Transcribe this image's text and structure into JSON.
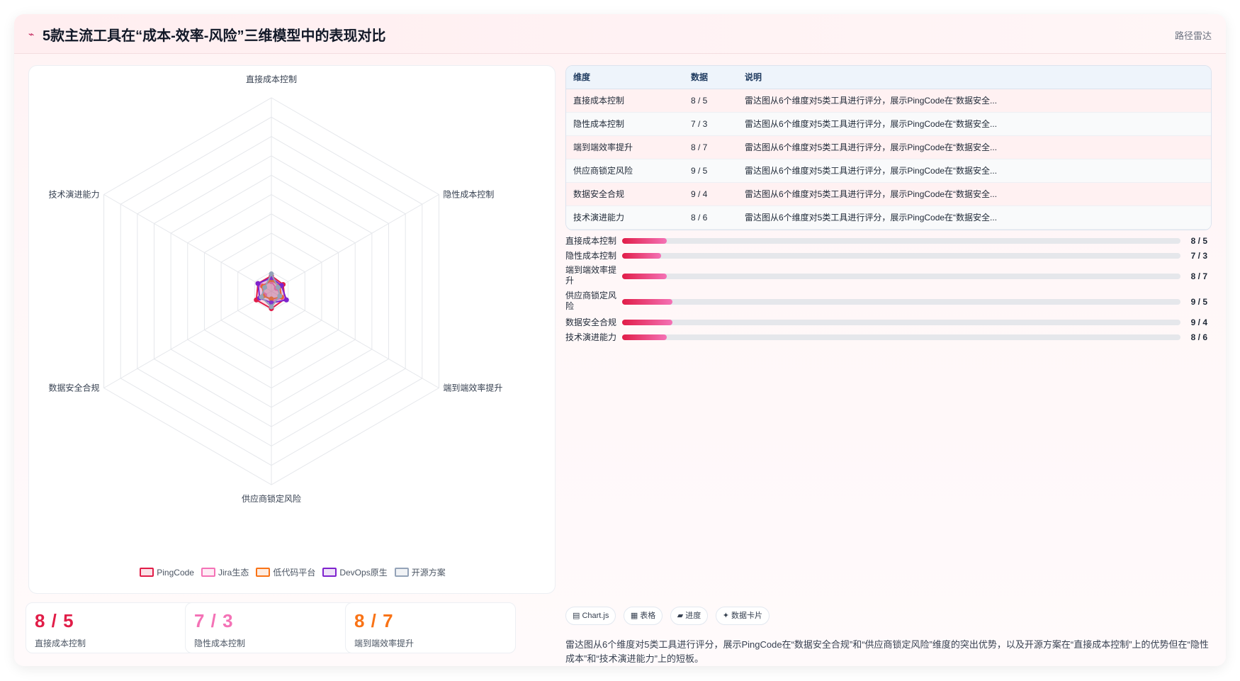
{
  "header": {
    "title_icon": "⌁",
    "title": "5款主流工具在“成本-效率-风险”三维模型中的表现对比",
    "badge": "路径雷达"
  },
  "chart_data": {
    "type": "radar",
    "axes": [
      "直接成本控制",
      "隐性成本控制",
      "端到端效率提升",
      "供应商锁定风险",
      "数据安全合规",
      "技术演进能力"
    ],
    "rlim": [
      0,
      100
    ],
    "rings": 10,
    "series": [
      {
        "name": "PingCode",
        "values": [
          8,
          7,
          8,
          9,
          9,
          8
        ],
        "color": "#e11d48"
      },
      {
        "name": "Jira生态",
        "values": [
          5,
          3,
          7,
          5,
          4,
          6
        ],
        "color": "#f472b6"
      },
      {
        "name": "低代码平台",
        "values": [
          6,
          5,
          6,
          4,
          5,
          5
        ],
        "color": "#f97316"
      },
      {
        "name": "DevOps原生",
        "values": [
          7,
          6,
          9,
          6,
          7,
          8
        ],
        "color": "#7e22ce"
      },
      {
        "name": "开源方案",
        "values": [
          9,
          4,
          5,
          8,
          6,
          4
        ],
        "color": "#94a3b8"
      }
    ]
  },
  "stats": [
    {
      "value": "8 / 5",
      "label": "直接成本控制",
      "color": "#e11d48"
    },
    {
      "value": "7 / 3",
      "label": "隐性成本控制",
      "color": "#f472b6"
    },
    {
      "value": "8 / 7",
      "label": "端到端效率提升",
      "color": "#f97316"
    }
  ],
  "table": {
    "headers": [
      "维度",
      "数据",
      "说明"
    ],
    "rows": [
      {
        "dim": "直接成本控制",
        "data": "8 / 5",
        "desc": "雷达图从6个维度对5类工具进行评分，展示PingCode在“数据安全..."
      },
      {
        "dim": "隐性成本控制",
        "data": "7 / 3",
        "desc": "雷达图从6个维度对5类工具进行评分，展示PingCode在“数据安全..."
      },
      {
        "dim": "端到端效率提升",
        "data": "8 / 7",
        "desc": "雷达图从6个维度对5类工具进行评分，展示PingCode在“数据安全..."
      },
      {
        "dim": "供应商锁定风险",
        "data": "9 / 5",
        "desc": "雷达图从6个维度对5类工具进行评分，展示PingCode在“数据安全..."
      },
      {
        "dim": "数据安全合规",
        "data": "9 / 4",
        "desc": "雷达图从6个维度对5类工具进行评分，展示PingCode在“数据安全..."
      },
      {
        "dim": "技术演进能力",
        "data": "8 / 6",
        "desc": "雷达图从6个维度对5类工具进行评分，展示PingCode在“数据安全..."
      }
    ]
  },
  "bars": [
    {
      "label": "直接成本控制",
      "value": "8 / 5",
      "fill": 8
    },
    {
      "label": "隐性成本控制",
      "value": "7 / 3",
      "fill": 7
    },
    {
      "label": "端到端效率提升",
      "value": "8 / 7",
      "fill": 8
    },
    {
      "label": "供应商锁定风险",
      "value": "9 / 5",
      "fill": 9
    },
    {
      "label": "数据安全合规",
      "value": "9 / 4",
      "fill": 9
    },
    {
      "label": "技术演进能力",
      "value": "8 / 6",
      "fill": 8
    }
  ],
  "chips": [
    "▤ Chart.js",
    "▦ 表格",
    "▰ 进度",
    "✦ 数据卡片"
  ],
  "summary": "雷达图从6个维度对5类工具进行评分，展示PingCode在“数据安全合规”和“供应商锁定风险”维度的突出优势，以及开源方案在“直接成本控制”上的优势但在“隐性成本”和“技术演进能力”上的短板。"
}
